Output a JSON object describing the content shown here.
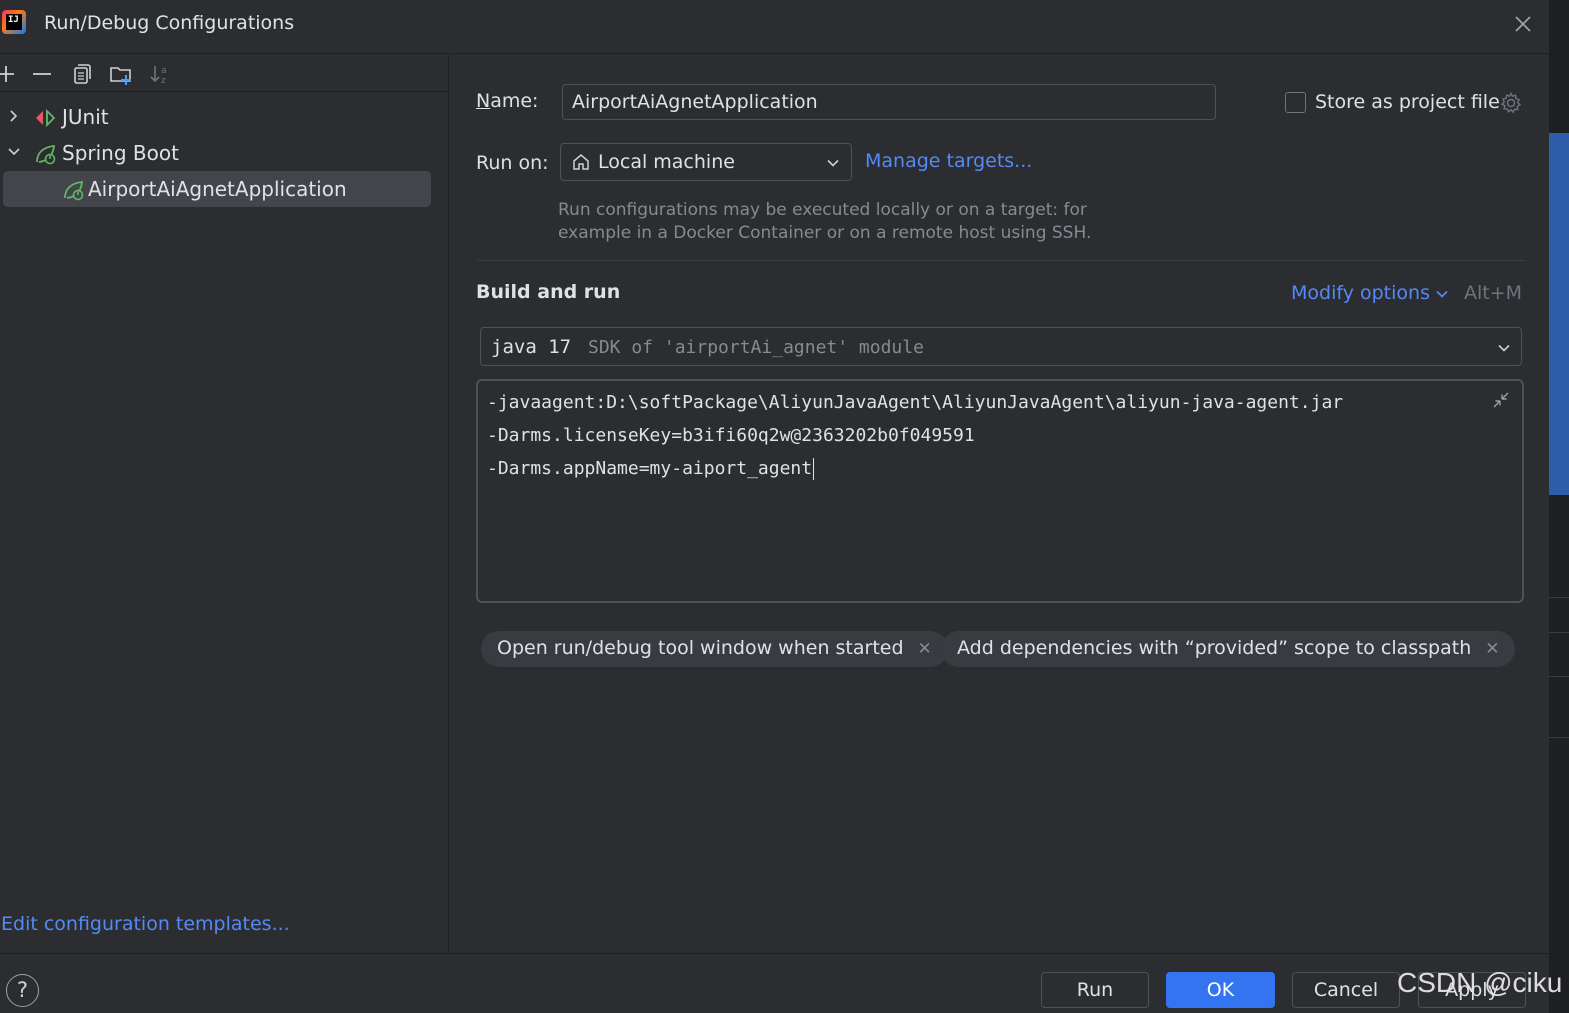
{
  "window": {
    "title": "Run/Debug Configurations"
  },
  "toolbar": {
    "icons": [
      "add-icon",
      "remove-icon",
      "copy-icon",
      "new-folder-icon",
      "sort-icon"
    ]
  },
  "tree": {
    "junit": "JUnit",
    "spring_boot": "Spring Boot",
    "app_item": "AirportAiAgnetApplication"
  },
  "left_footer": {
    "edit_templates": "Edit configuration templates..."
  },
  "form": {
    "name_label_first": "N",
    "name_label_rest": "ame:",
    "name_value": "AirportAiAgnetApplication",
    "store_label": "Store as project file",
    "store_checked": false,
    "run_on_label": "Run on:",
    "run_on_value": "Local machine",
    "manage_targets": "Manage targets...",
    "hint_line1": "Run configurations may be executed locally or on a target: for",
    "hint_line2": "example in a Docker Container or on a remote host using SSH.",
    "build_title": "Build and run",
    "modify_options": "Modify options",
    "modify_shortcut": "Alt+M",
    "jdk_main": "java 17",
    "jdk_sub": "SDK of 'airportAi_agnet' module",
    "vm_options": [
      "-javaagent:D:\\softPackage\\AliyunJavaAgent\\AliyunJavaAgent\\aliyun-java-agent.jar",
      "-Darms.licenseKey=b3ifi60q2w@2363202b0f049591",
      "-Darms.appName=my-aiport_agent"
    ],
    "chips": [
      "Open run/debug tool window when started",
      "Add dependencies with “provided” scope to classpath"
    ]
  },
  "buttons": {
    "run": "Run",
    "ok": "OK",
    "cancel": "Cancel",
    "apply": "Apply",
    "help": "?"
  },
  "watermark": "CSDN @ciku",
  "colors": {
    "background": "#2b2d30",
    "link": "#548af7",
    "primary_button": "#3574f0",
    "border": "#4e5157"
  }
}
